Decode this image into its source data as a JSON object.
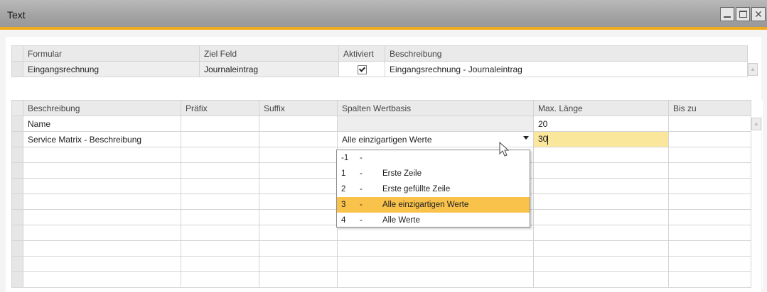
{
  "window": {
    "title": "Text"
  },
  "formular_table": {
    "headers": [
      "Formular",
      "Ziel Feld",
      "Aktiviert",
      "Beschreibung"
    ],
    "rows": [
      {
        "formular": "Eingangsrechnung",
        "ziel_feld": "Journaleintrag",
        "aktiviert": true,
        "beschreibung": "Eingangsrechnung - Journaleintrag"
      }
    ]
  },
  "fields_table": {
    "headers": [
      "Beschreibung",
      "Präfix",
      "Suffix",
      "Spalten Wertbasis",
      "Max. Länge",
      "Bis zu"
    ],
    "rows": [
      {
        "beschreibung": "Name",
        "praefix": "",
        "suffix": "",
        "spalten": "",
        "max_laenge": "20",
        "bis_zu": ""
      },
      {
        "beschreibung": "Service Matrix - Beschreibung",
        "praefix": "",
        "suffix": "",
        "spalten": "Alle einzigartigen Werte",
        "max_laenge": "30",
        "bis_zu": ""
      }
    ]
  },
  "dropdown": {
    "selected_value": "Alle einzigartigen Werte",
    "options": [
      {
        "key": "-1",
        "sep": "-",
        "label": "",
        "selected": false
      },
      {
        "key": "1",
        "sep": "-",
        "label": "Erste Zeile",
        "selected": false
      },
      {
        "key": "2",
        "sep": "-",
        "label": "Erste gefüllte Zeile",
        "selected": false
      },
      {
        "key": "3",
        "sep": "-",
        "label": "Alle einzigartigen Werte",
        "selected": true
      },
      {
        "key": "4",
        "sep": "-",
        "label": "Alle Werte",
        "selected": false
      }
    ]
  },
  "colors": {
    "accent": "#f0ac1c",
    "selected_option": "#f8c24b",
    "active_cell": "#fbe79c"
  }
}
